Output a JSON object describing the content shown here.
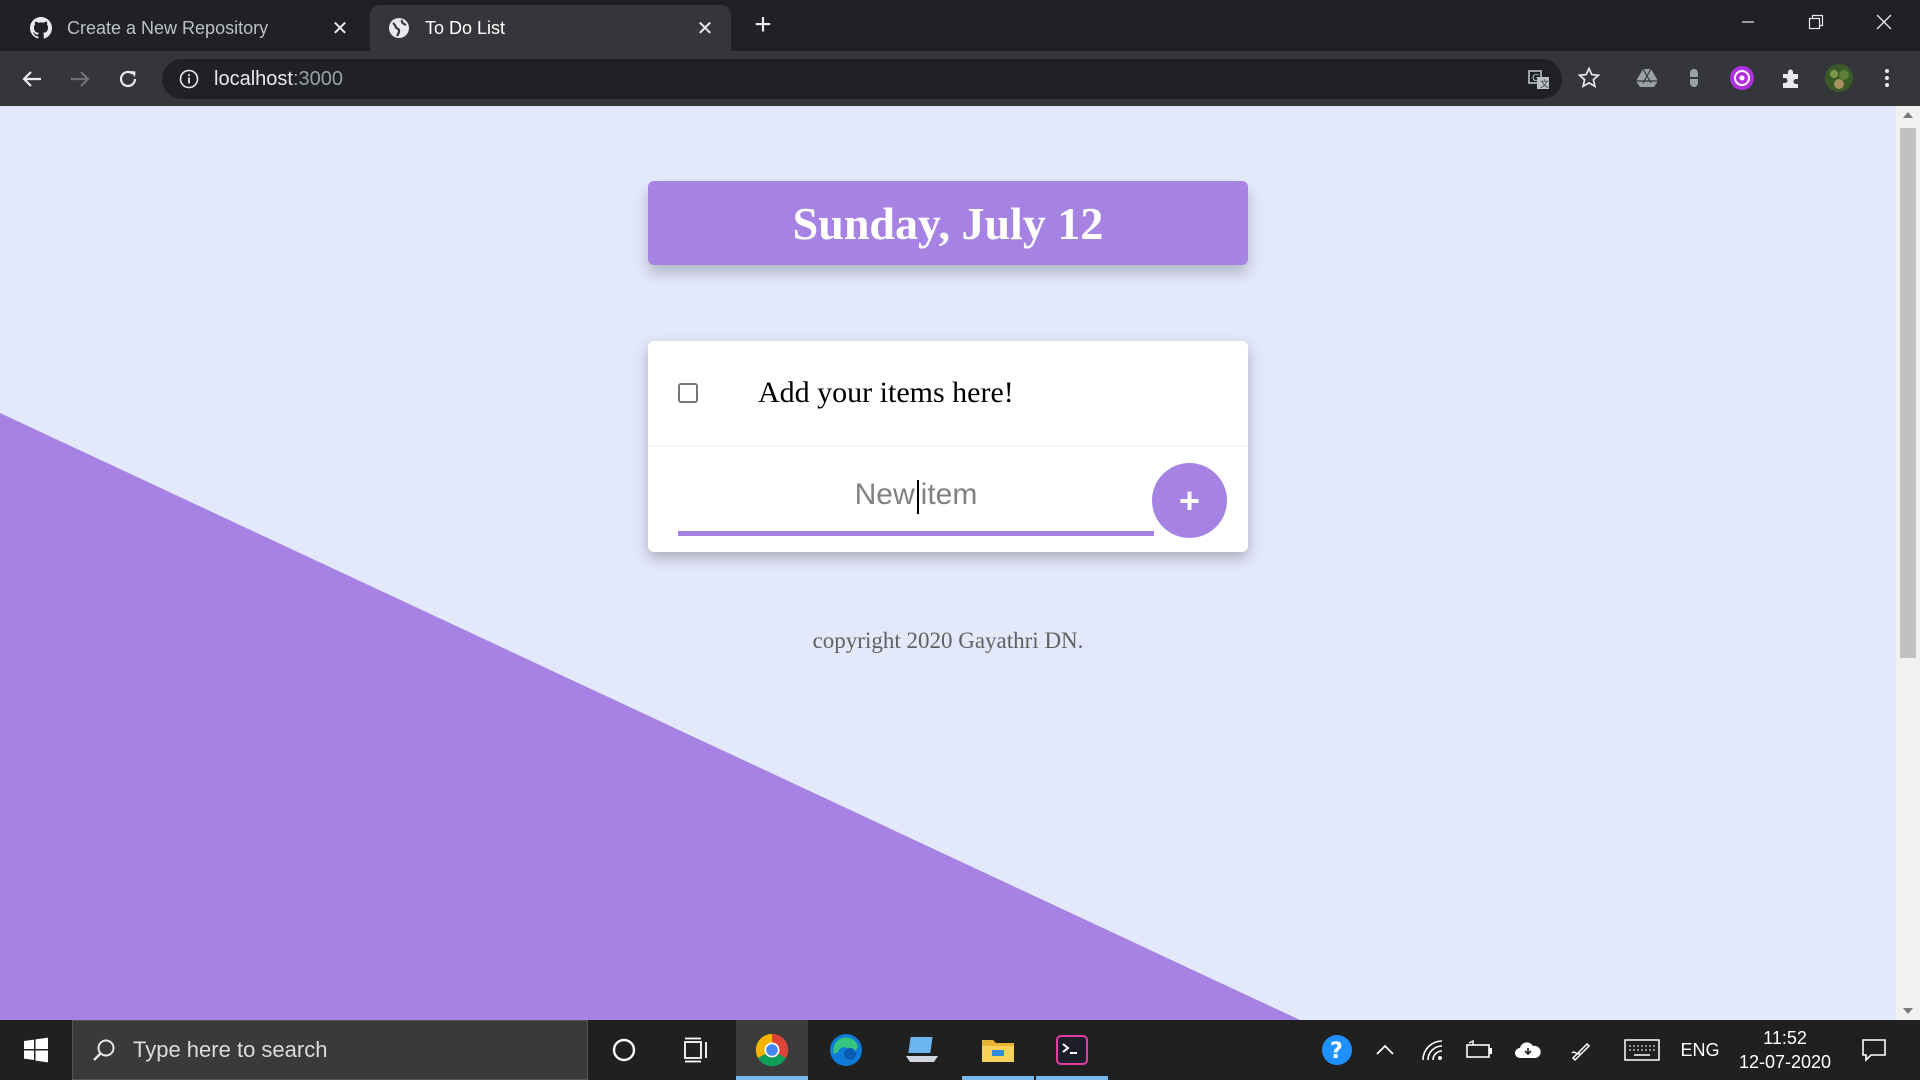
{
  "browser": {
    "tabs": [
      {
        "title": "Create a New Repository",
        "favicon": "github-icon",
        "active": false
      },
      {
        "title": "To Do List",
        "favicon": "globe-icon",
        "active": true
      }
    ],
    "new_tab_symbol": "+",
    "url": {
      "host": "localhost",
      "port": ":3000"
    },
    "close_symbol": "✕"
  },
  "page": {
    "heading": "Sunday, July 12",
    "items": [
      {
        "text": "Add your items here!",
        "checked": false
      }
    ],
    "new_item_placeholder_before": "New",
    "new_item_placeholder_after": "item",
    "add_button_label": "+",
    "footer": "copyright 2020 Gayathri DN."
  },
  "taskbar": {
    "search_placeholder": "Type here to search",
    "language": "ENG",
    "time": "11:52",
    "date": "12-07-2020"
  },
  "colors": {
    "accent": "#a683e3",
    "page_background": "#e3e8fb",
    "browser_frame": "#202124",
    "toolbar": "#35363a"
  }
}
